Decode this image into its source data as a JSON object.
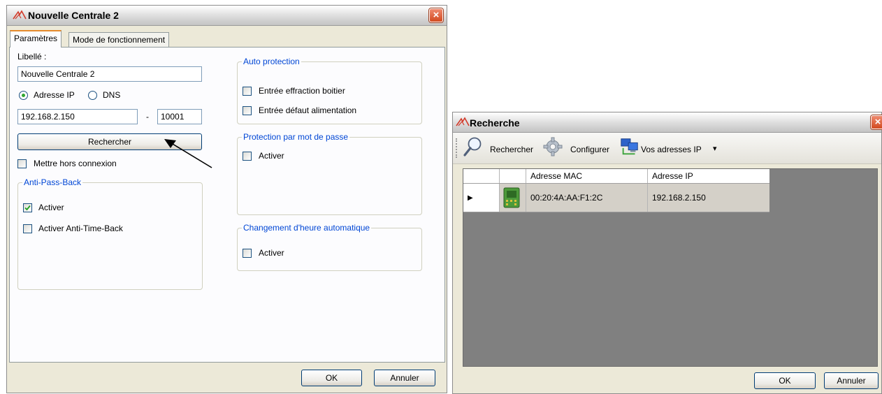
{
  "window1": {
    "title": "Nouvelle Centrale 2",
    "close_glyph": "×",
    "tabs": [
      {
        "label": "Paramètres",
        "active": true
      },
      {
        "label": "Mode de fonctionnement",
        "active": false
      }
    ],
    "libelle_label": "Libellé :",
    "libelle_value": "Nouvelle Centrale 2",
    "radio_ip_label": "Adresse IP",
    "radio_dns_label": "DNS",
    "ip_value": "192.168.2.150",
    "port_separator": "-",
    "port_value": "10001",
    "rechercher_label": "Rechercher",
    "offline_label": "Mettre hors connexion",
    "antipassback": {
      "legend": "Anti-Pass-Back",
      "activer_label": "Activer",
      "activer_checked": true,
      "antitime_label": "Activer Anti-Time-Back",
      "antitime_checked": false
    },
    "autoprotection": {
      "legend": "Auto protection",
      "item1": "Entrée effraction boitier",
      "item2": "Entrée défaut alimentation"
    },
    "password": {
      "legend": "Protection par mot de passe",
      "activer_label": "Activer"
    },
    "dst": {
      "legend": "Changement d'heure automatique",
      "activer_label": "Activer"
    },
    "ok_label": "OK",
    "cancel_label": "Annuler"
  },
  "window2": {
    "title": "Recherche",
    "close_glyph": "×",
    "toolbar": {
      "search_label": "Rechercher",
      "configure_label": "Configurer",
      "ip_label": "Vos adresses IP",
      "ip_dropdown_glyph": "▾"
    },
    "grid": {
      "columns": [
        "Adresse MAC",
        "Adresse IP"
      ],
      "rows": [
        {
          "mac": "00:20:4A:AA:F1:2C",
          "ip": "192.168.2.150"
        }
      ],
      "row_indicator": "▶"
    },
    "ok_label": "OK",
    "cancel_label": "Annuler"
  },
  "colors": {
    "group_legend": "#0046d5",
    "grid_background": "#808080",
    "tab_highlight": "#e68b2c"
  }
}
